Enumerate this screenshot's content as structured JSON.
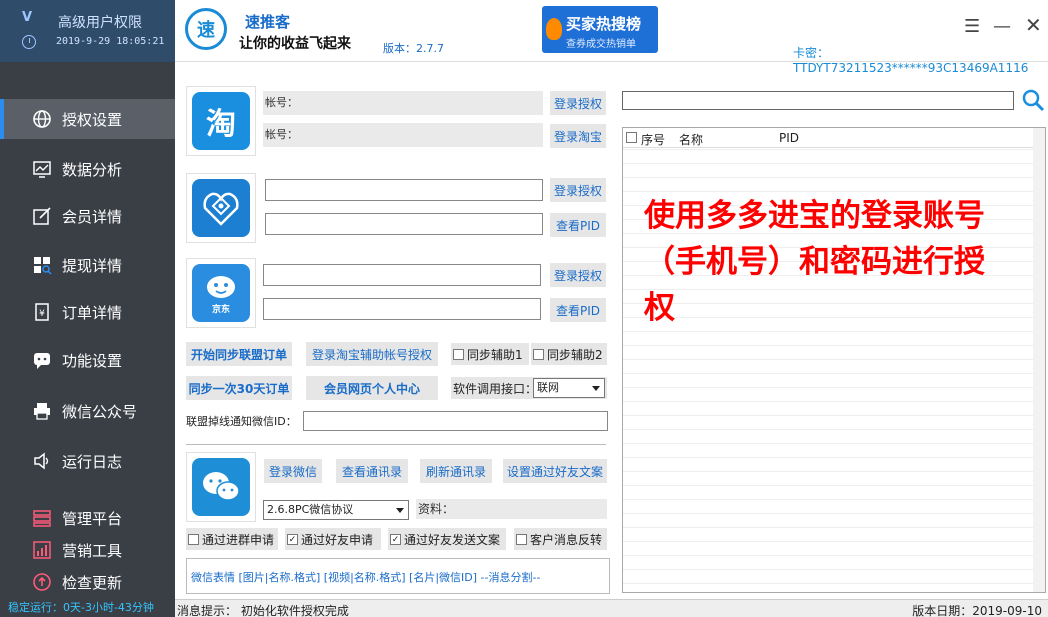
{
  "sidebar": {
    "title": "高级用户权限",
    "logo_text": "V",
    "time": "2019-9-29 18:05:21",
    "items": [
      {
        "label": "授权设置",
        "icon": "globe-icon"
      },
      {
        "label": "数据分析",
        "icon": "chart-icon"
      },
      {
        "label": "会员详情",
        "icon": "edit-icon"
      },
      {
        "label": "提现详情",
        "icon": "grid-search-icon"
      },
      {
        "label": "订单详情",
        "icon": "order-icon"
      },
      {
        "label": "功能设置",
        "icon": "chat-icon"
      },
      {
        "label": "微信公众号",
        "icon": "printer-icon"
      },
      {
        "label": "运行日志",
        "icon": "speaker-icon"
      },
      {
        "label": "管理平台",
        "icon": "layers-icon"
      },
      {
        "label": "营销工具",
        "icon": "bar-chart-icon"
      },
      {
        "label": "检查更新",
        "icon": "upload-icon"
      }
    ],
    "status": "稳定运行：0天-3小时-43分钟"
  },
  "header": {
    "logo_text": "速",
    "app_name": "速推客",
    "slogan": "让你的收益飞起来",
    "version": "版本：2.7.7",
    "promo_title": "买家热搜榜",
    "promo_sub": "查券成交热销单",
    "menu_glyph": "☰",
    "min_glyph": "—",
    "close_glyph": "✕",
    "card_key": "卡密：TTDYT73211523******93C13469A1116"
  },
  "taobao": {
    "logo_text": "淘",
    "account1_label": "帐号：",
    "account2_label": "帐号：",
    "btn_auth": "登录授权",
    "btn_login_taobao": "登录淘宝"
  },
  "pdd": {
    "btn_auth": "登录授权",
    "btn_pid": "查看PID"
  },
  "jd": {
    "logo_text": "京东",
    "btn_auth": "登录授权",
    "btn_pid": "查看PID"
  },
  "actions": {
    "sync_orders": "开始同步联盟订单",
    "login_taobao_assist": "登录淘宝辅助帐号授权",
    "sync_assist1": "同步辅助1",
    "sync_assist2": "同步辅助2",
    "sync_30days": "同步一次30天订单",
    "member_center": "会员网页个人中心",
    "api_label": "软件调用接口：",
    "api_value": "联网",
    "offline_notify_label": "联盟掉线通知微信ID："
  },
  "wechat": {
    "btn_login": "登录微信",
    "btn_view_contacts": "查看通讯录",
    "btn_refresh_contacts": "刷新通讯录",
    "btn_friend_text": "设置通过好友文案",
    "protocol_value": "2.6.8PC微信协议",
    "info_label": "资料：",
    "chk_group": "通过进群申请",
    "chk_friend": "通过好友申请",
    "chk_friend_text": "通过好友发送文案",
    "chk_feedback": "客户消息反转",
    "chk_group_checked": false,
    "chk_friend_checked": true,
    "chk_friend_text_checked": true,
    "chk_feedback_checked": false,
    "tips": "微信表情 [图片|名称.格式] [视频|名称.格式] [名片|微信ID]  --消息分割--"
  },
  "table": {
    "col_no": "序号",
    "col_name": "名称",
    "col_pid": "PID"
  },
  "overlay_note": "使用多多进宝的登录账号（手机号）和密码进行授权",
  "statusbar": {
    "message": "消息提示： 初始化软件授权完成",
    "date": "版本日期：2019-09-10"
  },
  "colors": {
    "accent": "#1a6cc9",
    "sidebar_bg": "#3a3f46",
    "highlight_red": "#ff0000",
    "taobao": "#1a8fe0",
    "pdd": "#1d7fd2",
    "jd": "#2a8de0",
    "wechat": "#1e8fd6"
  }
}
